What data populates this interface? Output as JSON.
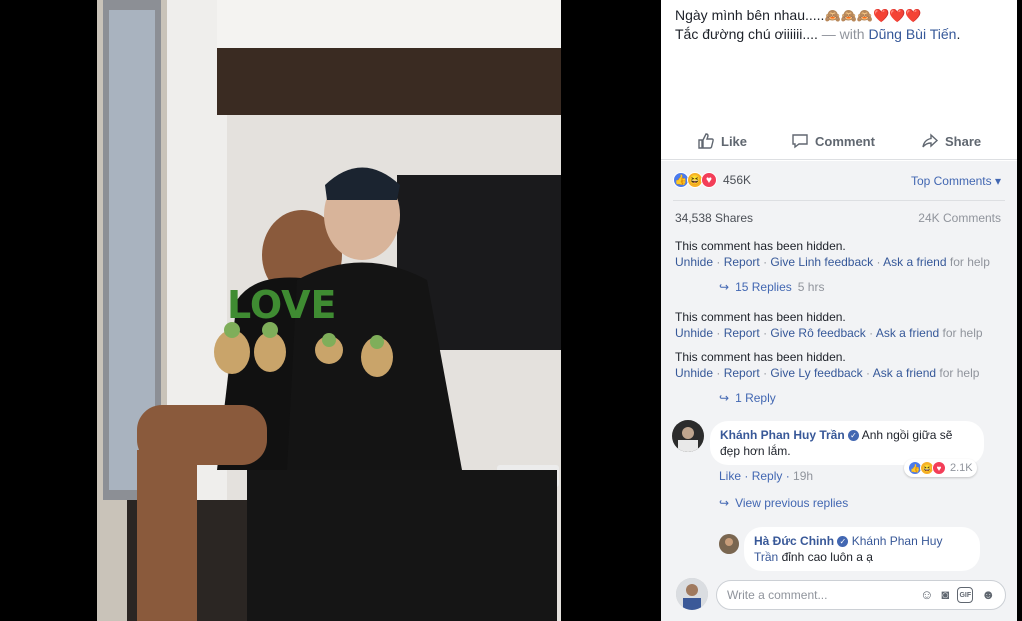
{
  "post": {
    "caption_line1": "Ngày mình bên nhau.....",
    "caption_line1_emoji": "🙈🙈🙈❤️❤️❤️",
    "caption_line2": "Tắc đường chú ơiiiiii....",
    "with_text": "— with",
    "tagged_user": "Dũng Bùi Tiến",
    "photo_text": "LOVE"
  },
  "actions": {
    "like_label": "Like",
    "comment_label": "Comment",
    "share_label": "Share"
  },
  "stats": {
    "reactions_count": "456K",
    "sort_label": "Top Comments ▾",
    "shares_label": "34,538 Shares",
    "comments_label": "24K Comments"
  },
  "hidden_comments": [
    {
      "text": "This comment has been hidden.",
      "unhide": "Unhide",
      "report": "Report",
      "feedback": "Give Linh feedback",
      "ask": "Ask a friend",
      "for_help": "for help",
      "replies": "15 Replies",
      "replies_time": "5 hrs"
    },
    {
      "text": "This comment has been hidden.",
      "unhide": "Unhide",
      "report": "Report",
      "feedback": "Give Rô feedback",
      "ask": "Ask a friend",
      "for_help": "for help"
    },
    {
      "text": "This comment has been hidden.",
      "unhide": "Unhide",
      "report": "Report",
      "feedback": "Give Ly feedback",
      "ask": "Ask a friend",
      "for_help": "for help",
      "replies": "1 Reply"
    }
  ],
  "comment1": {
    "author": "Khánh Phan Huy Trần",
    "text_line1": "Anh ngồi giữa sẽ",
    "text_line2": "đẹp hơn lắm.",
    "reaction_count": "2.1K",
    "like": "Like",
    "reply": "Reply",
    "time": "19h",
    "view_previous": "View previous replies"
  },
  "reply1": {
    "author": "Hà Đức Chinh",
    "tag_part1": "Khánh Phan Huy",
    "tag_part2": "Trần",
    "text": "đỉnh cao luôn a ạ"
  },
  "composer": {
    "placeholder": "Write a comment..."
  },
  "colors": {
    "link": "#365899",
    "accent": "#4267b2",
    "muted": "#90949c",
    "like_blue": "#4b7bec",
    "love_red": "#f33e58",
    "haha_yellow": "#f7b125"
  }
}
